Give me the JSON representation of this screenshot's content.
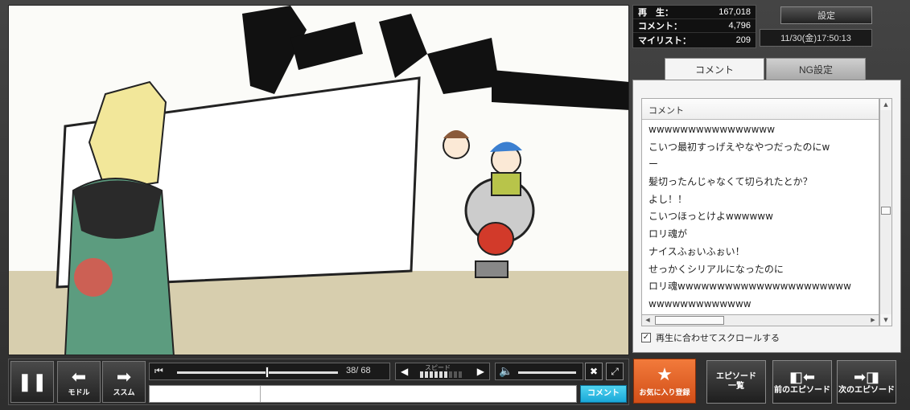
{
  "stats": {
    "views_label": "再　生：",
    "views": "167,018",
    "comments_label": "コメント：",
    "comments": "4,796",
    "mylist_label": "マイリスト：",
    "mylist": "209"
  },
  "header": {
    "settings": "設定",
    "datetime": "11/30(金)17:50:13"
  },
  "tabs": {
    "comment": "コメント",
    "ng": "NG設定"
  },
  "comment_list": {
    "column_header": "コメント",
    "items": [
      "wwwwwwwwwwwwwwww",
      "こいつ最初すっげえやなやつだったのにw",
      "ー",
      "髪切ったんじゃなくて切られたとか？",
      "よし！！",
      "こいつほっとけよwwwwww",
      "ロリ魂が",
      "ナイスふぉいふぉい！",
      "せっかくシリアルになったのに",
      "ロリ魂wwwwwwwwwwwwwwwwwwwwww",
      "wwwwwwwwwwwww"
    ],
    "sync_label": "再生に合わせてスクロールする"
  },
  "player": {
    "pause_label": "",
    "back_label": "モドル",
    "forward_label": "ススム",
    "time": "38/ 68",
    "position_fraction": 0.56,
    "speed_label": "スピード",
    "speed_level": 6,
    "speed_max": 9,
    "volume_fraction": 1.0,
    "submit": "コメント",
    "comment_value": ""
  },
  "footer": {
    "favorite": "お気に入り登録",
    "episode_list_top": "エピソード",
    "episode_list_bottom": "一覧",
    "prev_episode": "前のエピソード",
    "next_episode": "次のエピソード"
  },
  "icons": {
    "pause": "pause-icon",
    "back": "arrow-left-icon",
    "forward": "arrow-right-icon",
    "star": "star-icon",
    "volume": "speaker-icon",
    "popout": "popout-icon",
    "mute": "close-icon"
  }
}
